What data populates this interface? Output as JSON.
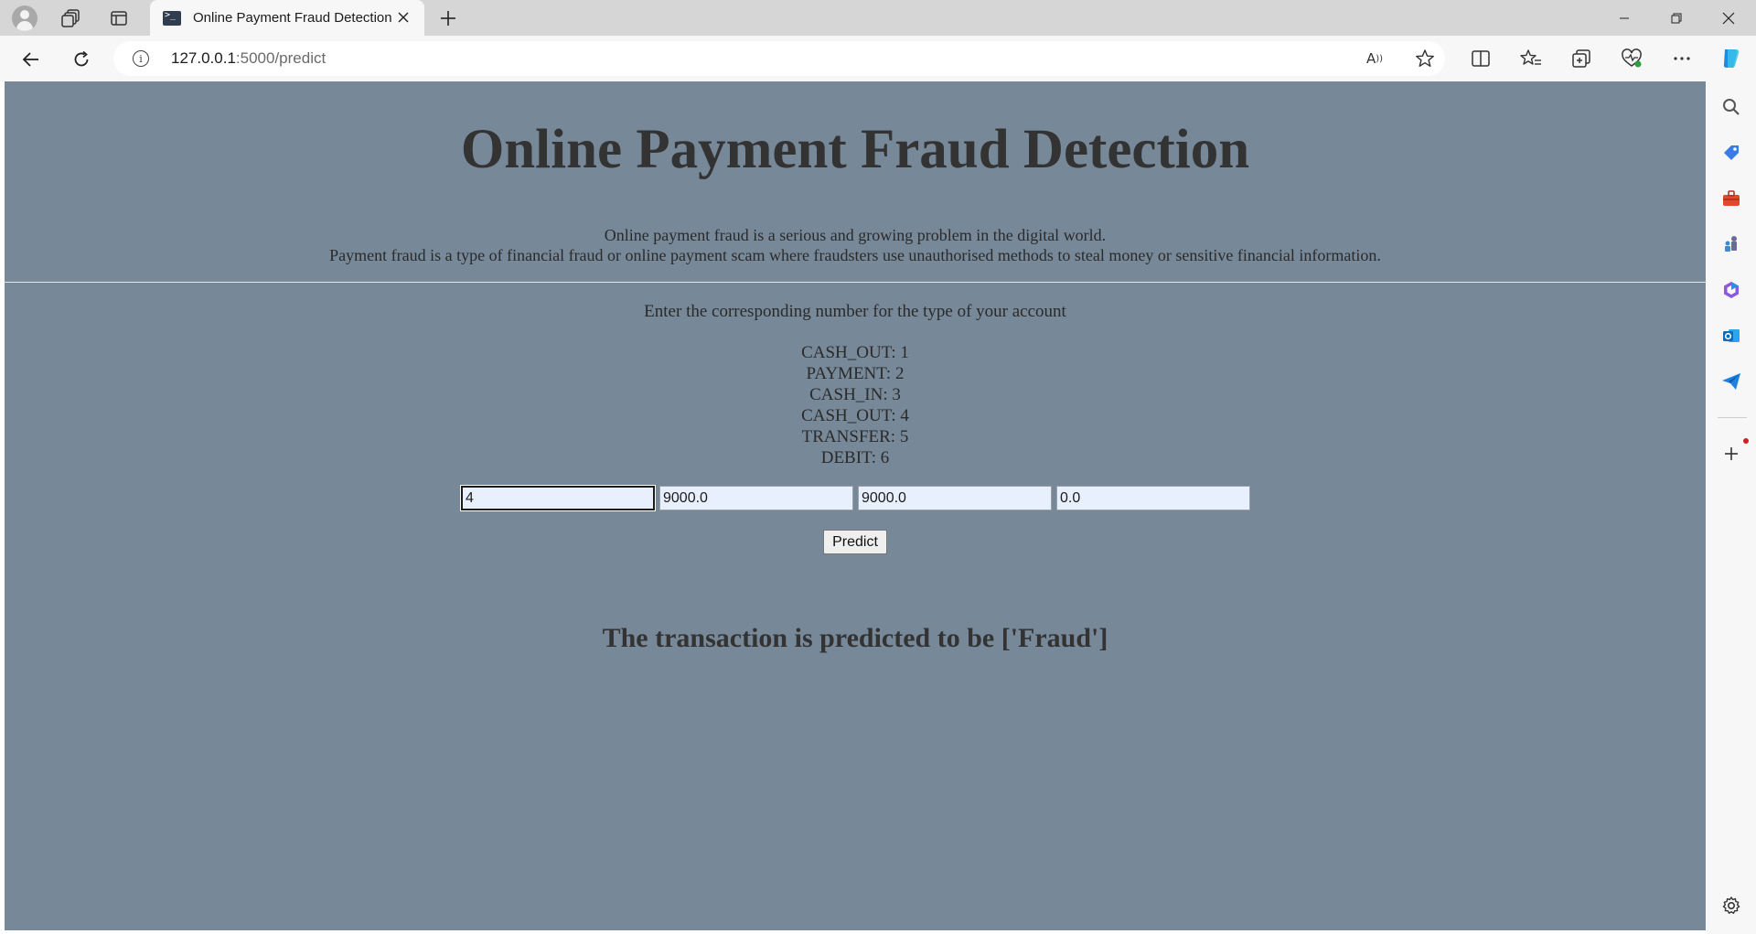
{
  "browser": {
    "tab_title": "Online Payment Fraud Detection",
    "url_host": "127.0.0.1",
    "url_path": ":5000/predict",
    "icons": [
      "profile-icon",
      "workspaces-icon",
      "tab-actions-icon",
      "close-icon",
      "plus-icon",
      "minimize-icon",
      "restore-icon",
      "close-window-icon",
      "back-arrow-icon",
      "refresh-icon",
      "info-icon",
      "read-aloud-icon",
      "star-icon",
      "split-screen-icon",
      "favorites-icon",
      "collections-icon",
      "browser-essentials-icon",
      "more-icon",
      "copilot-icon"
    ]
  },
  "page": {
    "title": "Online Payment Fraud Detection",
    "intro_line1": "Online payment fraud is a serious and growing problem in the digital world.",
    "intro_line2": "Payment fraud is a type of financial fraud or online payment scam where fraudsters use unauthorised methods to steal money or sensitive financial information.",
    "instruction": "Enter the corresponding number for the type of your account",
    "types": [
      "CASH_OUT: 1",
      "PAYMENT: 2",
      "CASH_IN: 3",
      "CASH_OUT: 4",
      "TRANSFER: 5",
      "DEBIT: 6"
    ],
    "inputs": [
      "4",
      "9000.0",
      "9000.0",
      "0.0"
    ],
    "predict_label": "Predict",
    "result": "The transaction is predicted to be ['Fraud']"
  },
  "sidebar": {
    "icons": [
      "search-icon",
      "shopping-tag-icon",
      "tools-icon",
      "games-icon",
      "microsoft-365-icon",
      "outlook-icon",
      "send-icon",
      "add-icon",
      "settings-icon"
    ]
  },
  "colors": {
    "page_background": "#778899",
    "text": "#333333",
    "input_background": "#e8f0fe"
  }
}
